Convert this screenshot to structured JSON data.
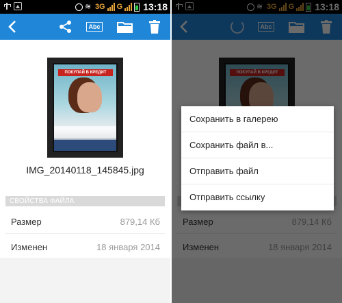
{
  "status_bar": {
    "network_1": "3G",
    "network_2": "G",
    "time": "13:18"
  },
  "file": {
    "name": "IMG_20140118_145845.jpg",
    "poster_headline": "ПОКУПАЙ В КРЕДИТ"
  },
  "properties": {
    "section_title": "СВОЙСТВА ФАЙЛА",
    "rows": [
      {
        "label": "Размер",
        "value": "879,14 Кб"
      },
      {
        "label": "Изменен",
        "value": "18 января 2014"
      }
    ]
  },
  "menu": {
    "items": [
      "Сохранить в галерею",
      "Сохранить файл в...",
      "Отправить файл",
      "Отправить ссылку"
    ]
  },
  "colors": {
    "toolbar": "#1f86d8",
    "network": "#e8a53a"
  },
  "icons": [
    "back-arrow-icon",
    "share-icon",
    "text-recognition-icon",
    "folder-icon",
    "trash-icon",
    "loading-spinner-icon"
  ]
}
